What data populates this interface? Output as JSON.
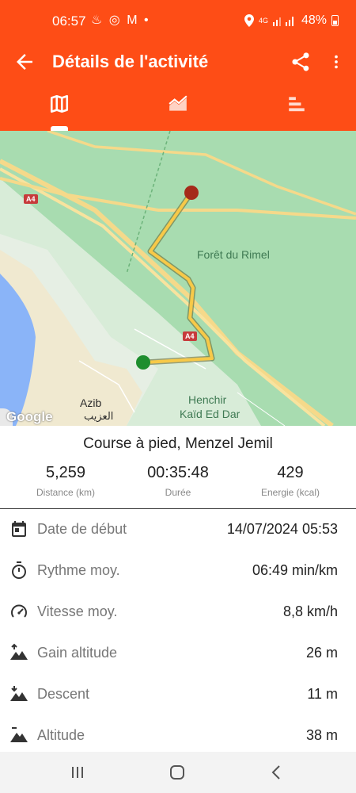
{
  "status_bar": {
    "time": "06:57",
    "notification_icons": "♨ ◎ M •",
    "network": "4G",
    "battery": "48%"
  },
  "app_bar": {
    "title": "Détails de l'activité",
    "background_color": "#fe4d16"
  },
  "tabs": [
    {
      "icon": "map-icon",
      "selected": true
    },
    {
      "icon": "area-chart-icon",
      "selected": false
    },
    {
      "icon": "bar-list-icon",
      "selected": false
    }
  ],
  "map": {
    "place_label": "Forêt du Rimel",
    "road_label_1": "A4",
    "road_label_2": "A4",
    "town_label": "Azib",
    "town_label_ar": "العزيب",
    "area_label_line1": "Henchir",
    "area_label_line2": "Kaïd Ed Dar",
    "attribution": "Google",
    "route_color": "#f7c948",
    "start_marker_color": "#1e8e2e",
    "end_marker_color": "#a52a1a"
  },
  "summary": {
    "title": "Course à pied, Menzel Jemil",
    "stats": [
      {
        "value": "5,259",
        "label": "Distance (km)"
      },
      {
        "value": "00:35:48",
        "label": "Durée"
      },
      {
        "value": "429",
        "label": "Energie (kcal)"
      }
    ]
  },
  "details": [
    {
      "icon": "calendar-icon",
      "label": "Date de début",
      "value": "14/07/2024 05:53"
    },
    {
      "icon": "timer-icon",
      "label": "Rythme moy.",
      "value": "06:49 min/km"
    },
    {
      "icon": "speedometer-icon",
      "label": "Vitesse moy.",
      "value": "8,8 km/h"
    },
    {
      "icon": "altitude-gain-icon",
      "label": "Gain altitude",
      "value": "26 m"
    },
    {
      "icon": "descent-icon",
      "label": "Descent",
      "value": "11 m"
    },
    {
      "icon": "altitude-icon",
      "label": "Altitude",
      "value": "38 m"
    }
  ]
}
